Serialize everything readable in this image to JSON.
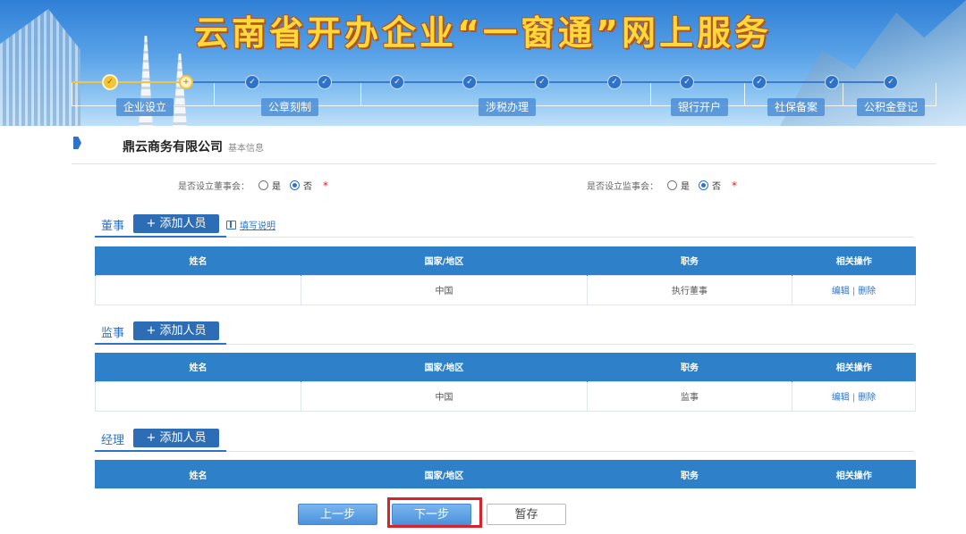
{
  "banner": {
    "title": "云南省开办企业“一窗通”网上服务"
  },
  "progress": {
    "steps": [
      {
        "label": "企业设立",
        "state": "done"
      },
      {
        "label": "公章刻制",
        "state": "todo"
      },
      {
        "label": "涉税办理",
        "state": "todo"
      },
      {
        "label": "银行开户",
        "state": "todo"
      },
      {
        "label": "社保备案",
        "state": "todo"
      },
      {
        "label": "公积金登记",
        "state": "todo"
      }
    ]
  },
  "company": {
    "name": "鼎云商务有限公司",
    "sub": "基本信息"
  },
  "questions": {
    "board": {
      "label": "是否设立董事会：",
      "yes": "是",
      "no": "否",
      "selected": "否",
      "required": "*"
    },
    "supervisors": {
      "label": "是否设立监事会：",
      "yes": "是",
      "no": "否",
      "selected": "否",
      "required": "*"
    }
  },
  "sections": {
    "directors": {
      "title": "董事",
      "add_label": "+ 添加人员",
      "help_label": "填写说明",
      "headers": [
        "姓名",
        "国家/地区",
        "职务",
        "相关操作"
      ],
      "rows": [
        {
          "name": "",
          "country": "中国",
          "position": "执行董事",
          "edit": "编辑",
          "sep": "|",
          "delete": "删除"
        }
      ]
    },
    "supervisors": {
      "title": "监事",
      "add_label": "+ 添加人员",
      "headers": [
        "姓名",
        "国家/地区",
        "职务",
        "相关操作"
      ],
      "rows": [
        {
          "name": "",
          "country": "中国",
          "position": "监事",
          "edit": "编辑",
          "sep": "|",
          "delete": "删除"
        }
      ]
    },
    "managers": {
      "title": "经理",
      "add_label": "+ 添加人员",
      "headers": [
        "姓名",
        "国家/地区",
        "职务",
        "相关操作"
      ]
    }
  },
  "buttons": {
    "prev": "上一步",
    "next": "下一步",
    "save": "暂存"
  },
  "colors": {
    "accent": "#2e73c9",
    "table_header": "#2e80c8",
    "highlight": "#d9222a",
    "required": "#e02020"
  }
}
